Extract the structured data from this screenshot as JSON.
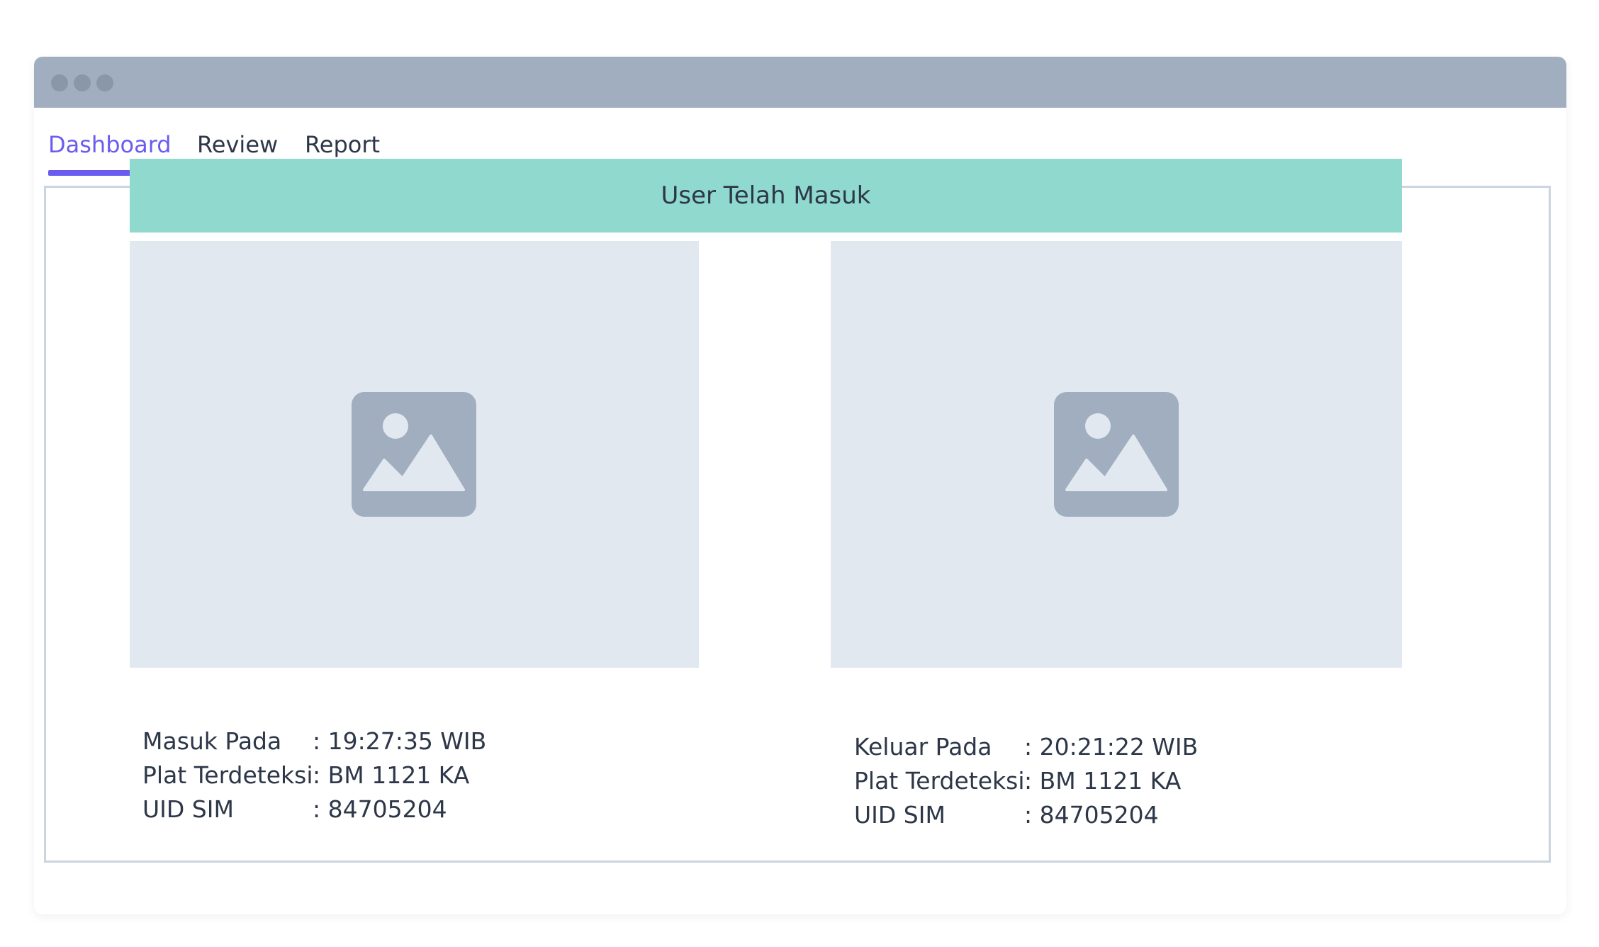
{
  "tabs": [
    {
      "label": "Dashboard",
      "active": true
    },
    {
      "label": "Review",
      "active": false
    },
    {
      "label": "Report",
      "active": false
    }
  ],
  "banner": {
    "text": "User Telah Masuk",
    "color": "#8fd9cf"
  },
  "accent_color": "#6b5cf0",
  "entry": {
    "image_icon": "image-placeholder-icon",
    "rows": [
      {
        "label": "Masuk Pada",
        "value": ": 19:27:35 WIB"
      },
      {
        "label": "Plat Terdeteksi",
        "value": ": BM 1121 KA"
      },
      {
        "label": "UID SIM",
        "value": ": 84705204"
      }
    ]
  },
  "exit": {
    "image_icon": "image-placeholder-icon",
    "rows": [
      {
        "label": "Keluar Pada",
        "value": ": 20:21:22 WIB"
      },
      {
        "label": "Plat Terdeteksi",
        "value": ": BM 1121 KA"
      },
      {
        "label": "UID SIM",
        "value": ": 84705204"
      }
    ]
  }
}
